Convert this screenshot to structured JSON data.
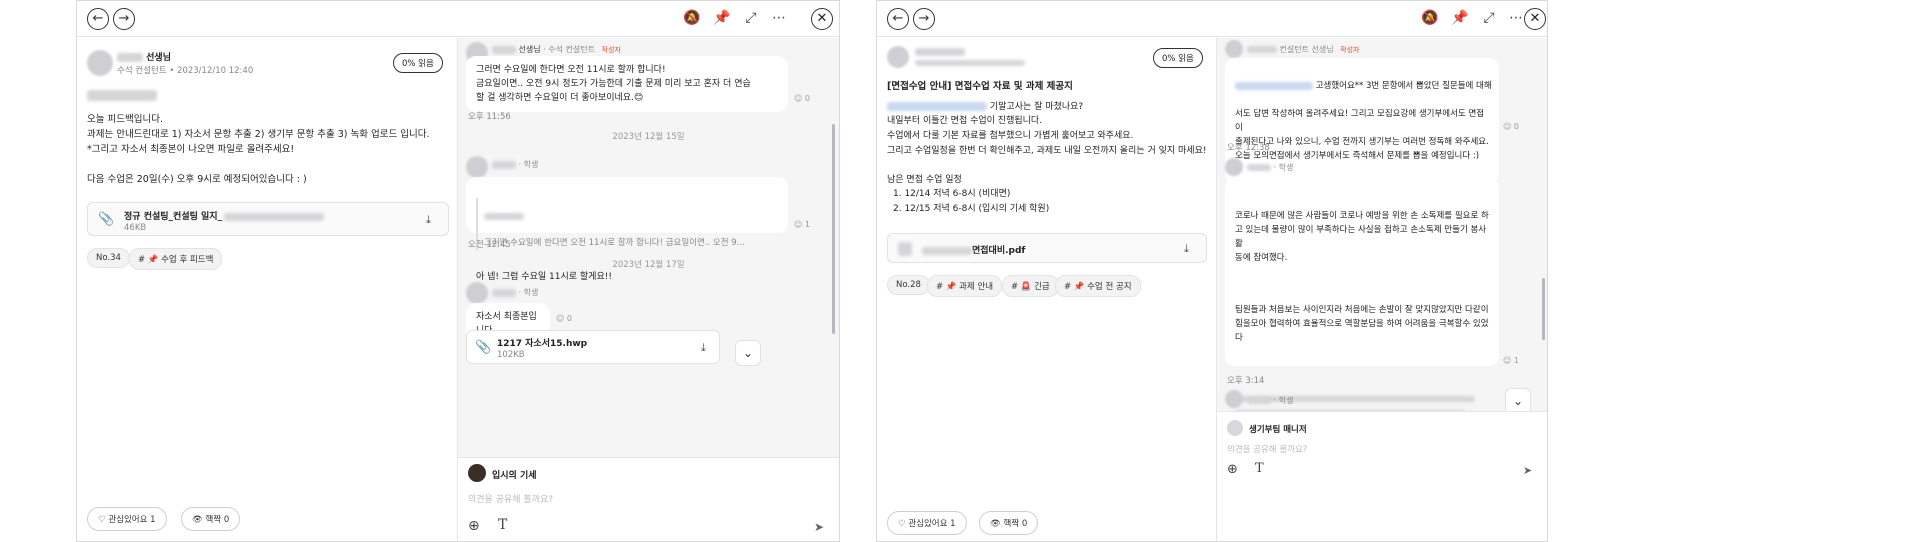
{
  "left": {
    "post": {
      "author_suffix": "선생님",
      "author_role_date": "수석 컨설턴트 • 2023/12/10 12:40",
      "read_badge": "0% 읽음",
      "body": "오늘 피드백입니다.\n과제는 안내드린대로 1) 자소서 문항 추출 2) 생기부 문항 추출 3) 녹화 업로드  입니다.\n*그리고 자소서 최종본이 나오면 파일로 올려주세요!\n\n다음 수업은 20일(수) 오후 9시로 예정되어있습니다 : )",
      "attachment": {
        "name": "정규 컨설팅_컨설팅 일지_",
        "size": "46KB"
      },
      "tags": [
        "No.34",
        "# 📌 수업 후 피드백"
      ],
      "like_button": "관심있어요 1",
      "watch_button": "핵짝 0"
    },
    "chat": {
      "msg1_name": "선생님",
      "msg1_role": "· 수석 컨설턴트",
      "msg1_badge": "작성자",
      "msg1_text": "그러면 수요일에 한다면 오전 11시로 할까 합니다!\n금요일이면.. 오전 9시 정도가 가능한데 기출 문제 미리 보고 혼자 더 연습\n할 걸 생각하면 수요일이 더 좋아보이네요.😊",
      "msg1_react": "0",
      "msg1_time": "오후 11:56",
      "date1": "2023년 12월 15일",
      "msg2_role": "· 학생",
      "msg2_quote": "그러면 수요일에 한다면 오전 11시로 할까 합니다! 금요일이면.. 오전 9...",
      "msg2_text": "아 넵! 그럼 수요일 11시로 할게요!!",
      "msg2_react": "1",
      "msg2_time": "오전 12:45",
      "date2": "2023년 12월 17일",
      "msg3_role": "· 학생",
      "msg3_text": "자소서 최종본입니다",
      "msg3_react": "0",
      "file_name": "1217 자소서15.hwp",
      "file_size": "102KB",
      "composer_name": "입시의 기세",
      "composer_placeholder": "의견을 공유해 볼까요?"
    }
  },
  "right": {
    "post": {
      "read_badge": "0% 읽음",
      "title": "[면접수업 안내] 면접수업 자료 및 과제 제공지",
      "line1_suffix": "기말고사는 잘 마쳤나요?",
      "body": "내일부터 이틀간 면접 수업이 진행됩니다.\n수업에서 다룰 기본 자료를 첨부했으니 가볍게 훑어보고 와주세요.\n그리고 수업일정을 한번 더 확인해주고, 과제도 내일 오전까지 올리는 거 잊지 마세요!",
      "schedule_title": "남은 면접 수업 일정",
      "schedule": [
        "1.  12/14 저녁 6-8시 (비대면)",
        "2.  12/15 저녁 6-8시 (입시의 기세 학원)"
      ],
      "attachment": {
        "name": "면접대비.pdf"
      },
      "tags": [
        "No.28",
        "# 📌 과제 안내",
        "# 🚨 긴급",
        "# 📌 수업 전 공지"
      ],
      "like_button": "관심있어요 1",
      "watch_button": "핵짝 0"
    },
    "chat": {
      "msg1_role": "컨설턴트 선생님",
      "msg1_badge": "작성자",
      "msg1_first": "고생했어요** 3번 문항에서 뽑았던 질문들에 대해",
      "msg1_text": "서도 답변 작성하여 올려주세요! 그리고 모집요강에 생기부에서도 면접이\n출제된다고 나와 있으니, 수업 전까지 생기부는 여러번 정독해 와주세요.\n오늘 모의면접에서 생기부에서도 즉석해서 문제를 뽑을 예정입니다 :)",
      "msg1_react": "0",
      "msg1_time": "오후 12:38",
      "msg2_role": "· 학생",
      "msg2_p1": "코로나 때문에 많은 사람들이  코로나 예방을 위한 손 소독제를 필요로 하\n고 있는데 물량이 많이 부족하다는 사실을 접하고 손소독제 만들기 봉사활\n동에 참여했다.",
      "msg2_p2": "팀원들과 처음보는 사이인지라 처음에는 손발이 잘 맞지않았지만 다같이\n힘을모아 협력하여  효율적으로 역할분담을 하여 어려움을 극복할수 있었\n다",
      "msg2_react": "1",
      "msg2_time": "오후 3:14",
      "msg3_role": "· 학생",
      "composer_name": "생기부팀 매니저",
      "composer_placeholder": "의견을 공유해 볼까요?"
    }
  }
}
